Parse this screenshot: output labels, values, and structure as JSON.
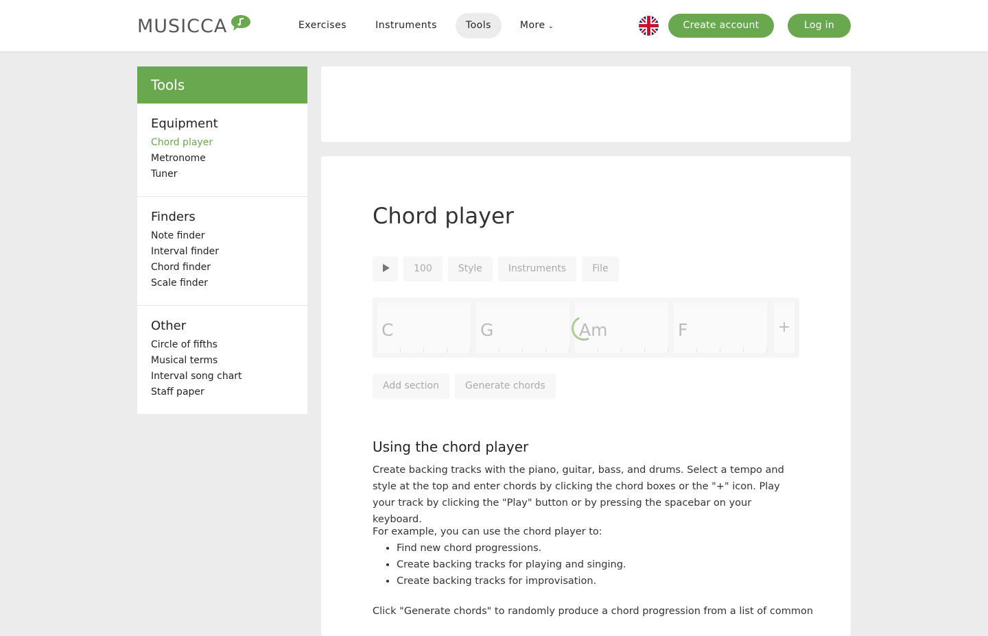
{
  "header": {
    "logo_text": "MUSICCA",
    "nav": [
      "Exercises",
      "Instruments",
      "Tools",
      "More"
    ],
    "create_account": "Create account",
    "log_in": "Log in"
  },
  "sidebar": {
    "title": "Tools",
    "groups": [
      {
        "heading": "Equipment",
        "items": [
          "Chord player",
          "Metronome",
          "Tuner"
        ]
      },
      {
        "heading": "Finders",
        "items": [
          "Note finder",
          "Interval finder",
          "Chord finder",
          "Scale finder"
        ]
      },
      {
        "heading": "Other",
        "items": [
          "Circle of fifths",
          "Musical terms",
          "Interval song chart",
          "Staff paper"
        ]
      }
    ]
  },
  "main": {
    "title": "Chord player",
    "toolbar": {
      "tempo": "100",
      "style": "Style",
      "instruments": "Instruments",
      "file": "File"
    },
    "chords": [
      "C",
      "G",
      "Am",
      "F"
    ],
    "add_chord": "+",
    "add_section": "Add section",
    "generate_chords": "Generate chords",
    "section_title": "Using the chord player",
    "paragraph1": "Create backing tracks with the piano, guitar, bass, and drums. Select a tempo and style at the top and enter chords by clicking the chord boxes or the \"+\" icon. Play your track by clicking the \"Play\" button or by pressing the spacebar on your keyboard.",
    "paragraph2": "For example, you can use the chord player to:",
    "list": [
      "Find new chord progressions.",
      "Create backing tracks for playing and singing.",
      "Create backing tracks for improvisation."
    ],
    "paragraph3": "Click \"Generate chords\" to randomly produce a chord progression from a list of common"
  },
  "colors": {
    "accent": "#6aa84f"
  }
}
